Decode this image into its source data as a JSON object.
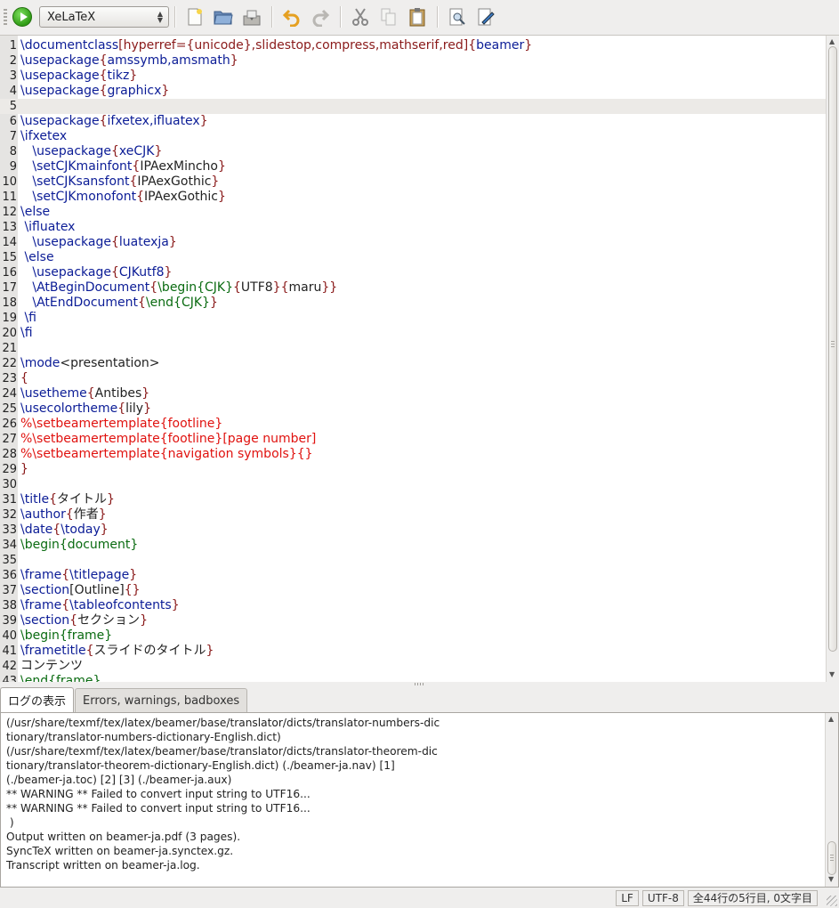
{
  "toolbar": {
    "compiler": "XeLaTeX",
    "buttons": [
      "new-file-icon",
      "open-folder-icon",
      "save-icon",
      "undo-icon",
      "redo-icon",
      "cut-icon",
      "copy-icon",
      "paste-icon",
      "preview-icon",
      "find-replace-icon"
    ]
  },
  "editor": {
    "current_line": 5,
    "lines": [
      [
        [
          "cmd",
          "\\documentclass"
        ],
        [
          "br",
          "[hyperref={unicode},slidestop,compress,mathserif,red]{"
        ],
        [
          "cmd",
          "beamer"
        ],
        [
          "br",
          "}"
        ]
      ],
      [
        [
          "cmd",
          "\\usepackage"
        ],
        [
          "br",
          "{"
        ],
        [
          "cmd",
          "amssymb,amsmath"
        ],
        [
          "br",
          "}"
        ]
      ],
      [
        [
          "cmd",
          "\\usepackage"
        ],
        [
          "br",
          "{"
        ],
        [
          "cmd",
          "tikz"
        ],
        [
          "br",
          "}"
        ]
      ],
      [
        [
          "cmd",
          "\\usepackage"
        ],
        [
          "br",
          "{"
        ],
        [
          "cmd",
          "graphicx"
        ],
        [
          "br",
          "}"
        ]
      ],
      [],
      [
        [
          "cmd",
          "\\usepackage"
        ],
        [
          "br",
          "{"
        ],
        [
          "cmd",
          "ifxetex,ifluatex"
        ],
        [
          "br",
          "}"
        ]
      ],
      [
        [
          "cmd",
          "\\ifxetex"
        ]
      ],
      [
        [
          "txt",
          "   "
        ],
        [
          "cmd",
          "\\usepackage"
        ],
        [
          "br",
          "{"
        ],
        [
          "cmd",
          "xeCJK"
        ],
        [
          "br",
          "}"
        ]
      ],
      [
        [
          "txt",
          "   "
        ],
        [
          "cmd",
          "\\setCJKmainfont"
        ],
        [
          "br",
          "{"
        ],
        [
          "txt",
          "IPAexMincho"
        ],
        [
          "br",
          "}"
        ]
      ],
      [
        [
          "txt",
          "   "
        ],
        [
          "cmd",
          "\\setCJKsansfont"
        ],
        [
          "br",
          "{"
        ],
        [
          "txt",
          "IPAexGothic"
        ],
        [
          "br",
          "}"
        ]
      ],
      [
        [
          "txt",
          "   "
        ],
        [
          "cmd",
          "\\setCJKmonofont"
        ],
        [
          "br",
          "{"
        ],
        [
          "txt",
          "IPAexGothic"
        ],
        [
          "br",
          "}"
        ]
      ],
      [
        [
          "cmd",
          "\\else"
        ]
      ],
      [
        [
          "txt",
          " "
        ],
        [
          "cmd",
          "\\ifluatex"
        ]
      ],
      [
        [
          "txt",
          "   "
        ],
        [
          "cmd",
          "\\usepackage"
        ],
        [
          "br",
          "{"
        ],
        [
          "cmd",
          "luatexja"
        ],
        [
          "br",
          "}"
        ]
      ],
      [
        [
          "txt",
          " "
        ],
        [
          "cmd",
          "\\else"
        ]
      ],
      [
        [
          "txt",
          "   "
        ],
        [
          "cmd",
          "\\usepackage"
        ],
        [
          "br",
          "{"
        ],
        [
          "cmd",
          "CJKutf8"
        ],
        [
          "br",
          "}"
        ]
      ],
      [
        [
          "txt",
          "   "
        ],
        [
          "cmd",
          "\\AtBeginDocument"
        ],
        [
          "br",
          "{"
        ],
        [
          "env",
          "\\begin{CJK}"
        ],
        [
          "br",
          "{"
        ],
        [
          "txt",
          "UTF8"
        ],
        [
          "br",
          "}{"
        ],
        [
          "txt",
          "maru"
        ],
        [
          "br",
          "}}"
        ]
      ],
      [
        [
          "txt",
          "   "
        ],
        [
          "cmd",
          "\\AtEndDocument"
        ],
        [
          "br",
          "{"
        ],
        [
          "env",
          "\\end{CJK}"
        ],
        [
          "br",
          "}"
        ]
      ],
      [
        [
          "txt",
          " "
        ],
        [
          "cmd",
          "\\fi"
        ]
      ],
      [
        [
          "cmd",
          "\\fi"
        ]
      ],
      [],
      [
        [
          "cmd",
          "\\mode"
        ],
        [
          "txt",
          "<presentation>"
        ]
      ],
      [
        [
          "br",
          "{"
        ]
      ],
      [
        [
          "cmd",
          "\\usetheme"
        ],
        [
          "br",
          "{"
        ],
        [
          "txt",
          "Antibes"
        ],
        [
          "br",
          "}"
        ]
      ],
      [
        [
          "cmd",
          "\\usecolortheme"
        ],
        [
          "br",
          "{"
        ],
        [
          "txt",
          "lily"
        ],
        [
          "br",
          "}"
        ]
      ],
      [
        [
          "cmt",
          "%\\setbeamertemplate{footline}"
        ]
      ],
      [
        [
          "cmt",
          "%\\setbeamertemplate{footline}[page number]"
        ]
      ],
      [
        [
          "cmt",
          "%\\setbeamertemplate{navigation symbols}{}"
        ]
      ],
      [
        [
          "br",
          "}"
        ]
      ],
      [],
      [
        [
          "cmd",
          "\\title"
        ],
        [
          "br",
          "{"
        ],
        [
          "txt",
          "タイトル"
        ],
        [
          "br",
          "}"
        ]
      ],
      [
        [
          "cmd",
          "\\author"
        ],
        [
          "br",
          "{"
        ],
        [
          "txt",
          "作者"
        ],
        [
          "br",
          "}"
        ]
      ],
      [
        [
          "cmd",
          "\\date"
        ],
        [
          "br",
          "{"
        ],
        [
          "cmd",
          "\\today"
        ],
        [
          "br",
          "}"
        ]
      ],
      [
        [
          "env",
          "\\begin{document}"
        ]
      ],
      [],
      [
        [
          "cmd",
          "\\frame"
        ],
        [
          "br",
          "{"
        ],
        [
          "cmd",
          "\\titlepage"
        ],
        [
          "br",
          "}"
        ]
      ],
      [
        [
          "cmd",
          "\\section"
        ],
        [
          "txt",
          "[Outline]"
        ],
        [
          "br",
          "{}"
        ]
      ],
      [
        [
          "cmd",
          "\\frame"
        ],
        [
          "br",
          "{"
        ],
        [
          "cmd",
          "\\tableofcontents"
        ],
        [
          "br",
          "}"
        ]
      ],
      [
        [
          "cmd",
          "\\section"
        ],
        [
          "br",
          "{"
        ],
        [
          "txt",
          "セクション"
        ],
        [
          "br",
          "}"
        ]
      ],
      [
        [
          "env",
          "\\begin{frame}"
        ]
      ],
      [
        [
          "cmd",
          "\\frametitle"
        ],
        [
          "br",
          "{"
        ],
        [
          "txt",
          "スライドのタイトル"
        ],
        [
          "br",
          "}"
        ]
      ],
      [
        [
          "txt",
          "コンテンツ"
        ]
      ],
      [
        [
          "env",
          "\\end{frame}"
        ]
      ]
    ]
  },
  "tabs": [
    {
      "label": "ログの表示",
      "active": true
    },
    {
      "label": "Errors, warnings, badboxes",
      "active": false
    }
  ],
  "log": {
    "text": "(/usr/share/texmf/tex/latex/beamer/base/translator/dicts/translator-numbers-dic\ntionary/translator-numbers-dictionary-English.dict)\n(/usr/share/texmf/tex/latex/beamer/base/translator/dicts/translator-theorem-dic\ntionary/translator-theorem-dictionary-English.dict) (./beamer-ja.nav) [1]\n(./beamer-ja.toc) [2] [3] (./beamer-ja.aux)\n** WARNING ** Failed to convert input string to UTF16...\n** WARNING ** Failed to convert input string to UTF16...\n )\nOutput written on beamer-ja.pdf (3 pages).\nSyncTeX written on beamer-ja.synctex.gz.\nTranscript written on beamer-ja.log."
  },
  "status": {
    "line_ending": "LF",
    "encoding": "UTF-8",
    "position": "全44行の5行目, 0文字目"
  }
}
